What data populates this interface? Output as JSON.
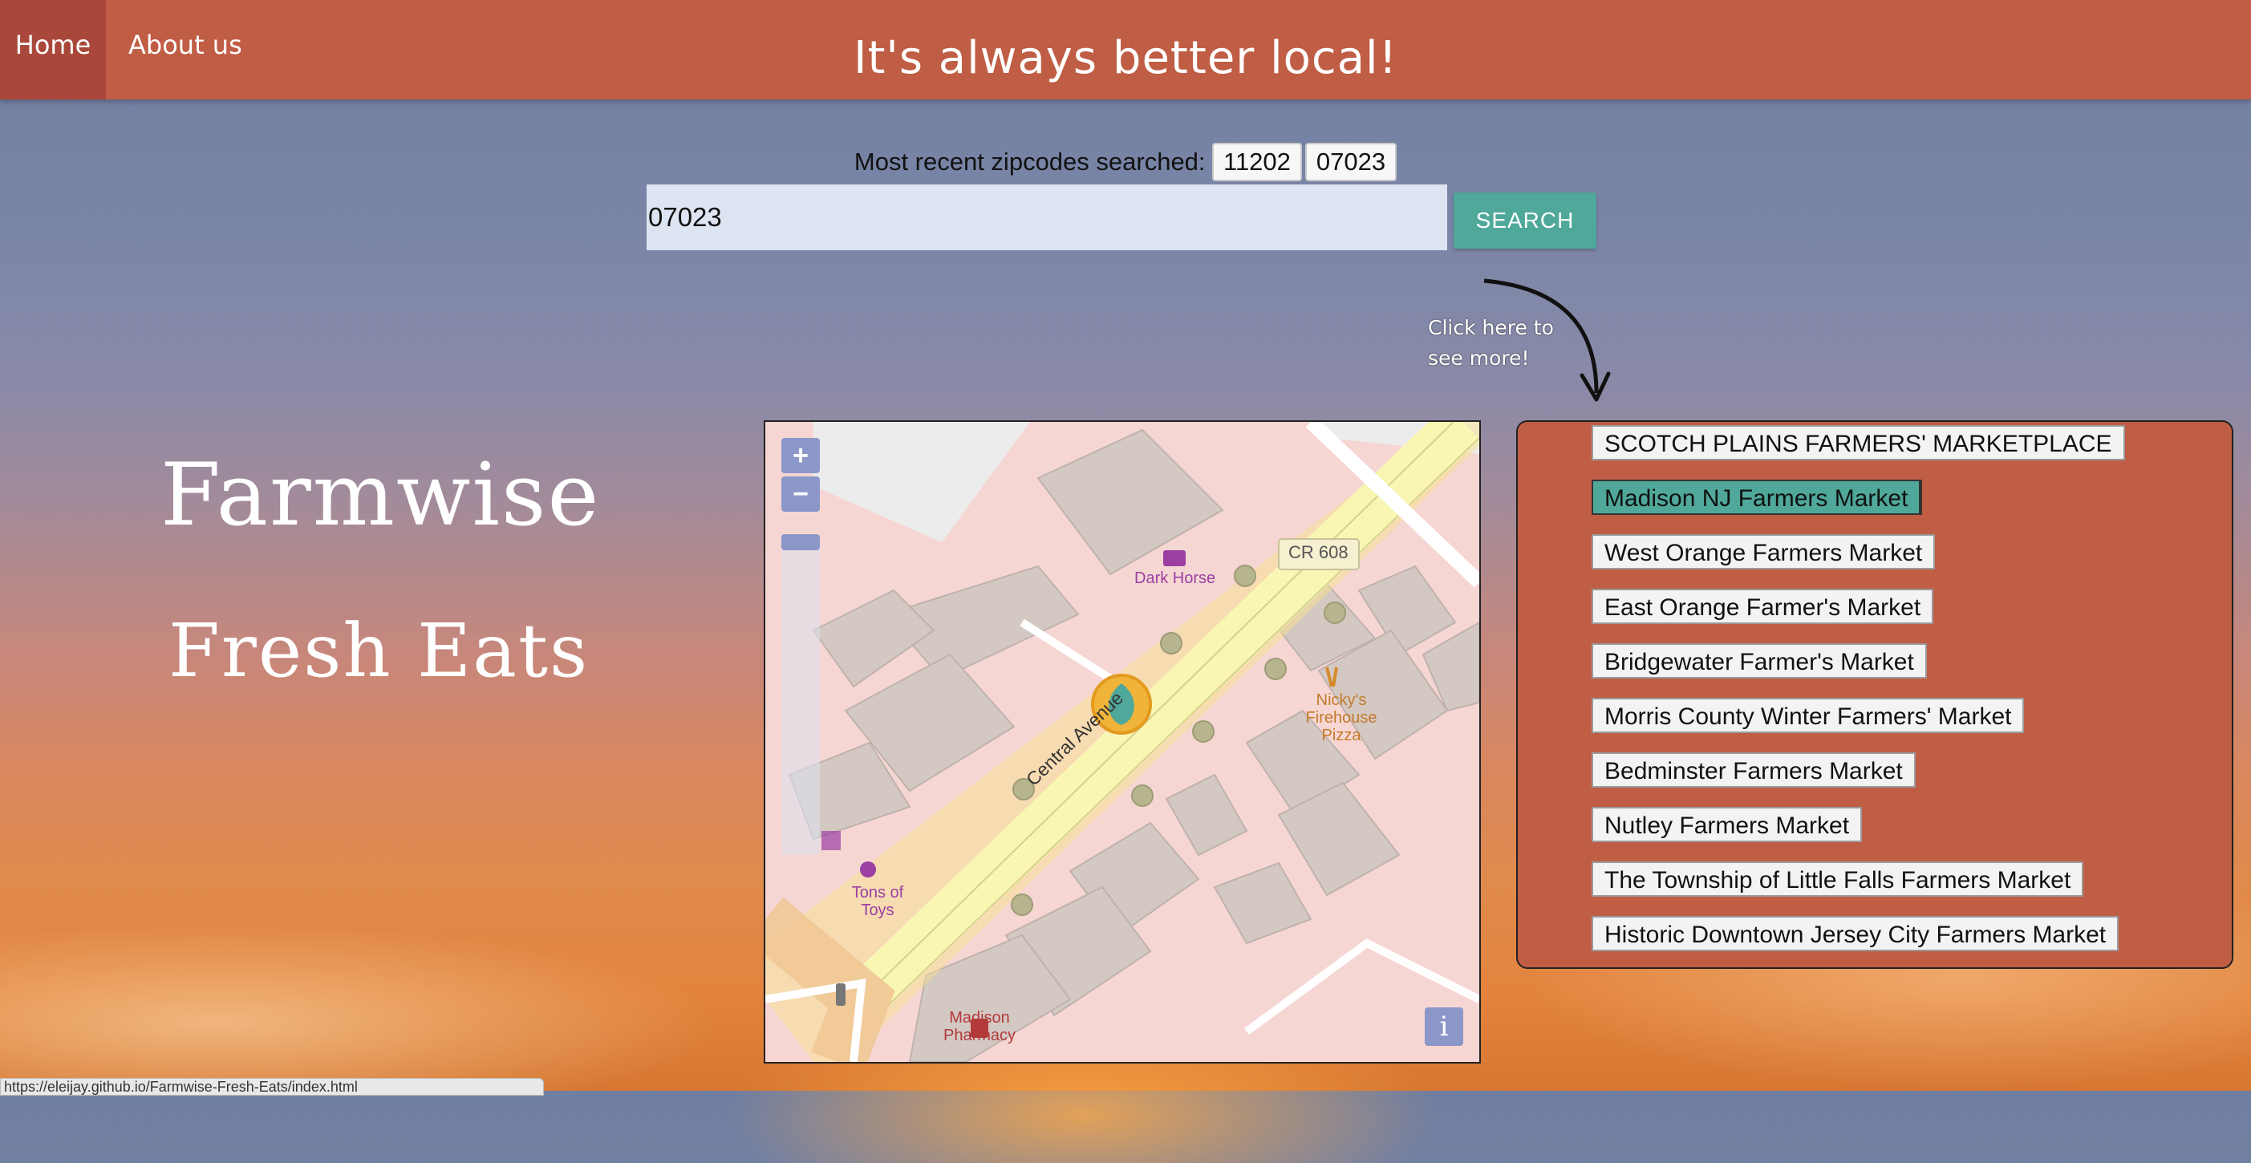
{
  "nav": {
    "home": "Home",
    "about": "About us",
    "tagline": "It's always better local!"
  },
  "search": {
    "recent_label": "Most recent zipcodes searched:",
    "recent": [
      "11202",
      "07023"
    ],
    "value": "07023",
    "button": "SEARCH"
  },
  "hint": {
    "line1": "Click here to",
    "line2": "see more!"
  },
  "brand": {
    "line1": "Farmwise",
    "line2": "Fresh Eats"
  },
  "map": {
    "zoom_in": "+",
    "zoom_out": "−",
    "info": "i",
    "road_label": "Central Avenue",
    "route_shield": "CR 608",
    "poi": {
      "dark_horse": "Dark Horse",
      "nickys_1": "Nicky's",
      "nickys_2": "Firehouse",
      "nickys_3": "Pizza",
      "tons_1": "Tons of",
      "tons_2": "Toys",
      "pharmacy_1": "Madison",
      "pharmacy_2": "Pharmacy"
    }
  },
  "markets": [
    "SCOTCH PLAINS FARMERS' MARKETPLACE",
    "Madison NJ Farmers Market",
    "West Orange Farmers Market",
    "East Orange Farmer's Market",
    "Bridgewater Farmer's Market",
    "Morris County Winter Farmers' Market",
    "Bedminster Farmers Market",
    "Nutley Farmers Market",
    "The Township of Little Falls Farmers Market",
    "Historic Downtown Jersey City Farmers Market"
  ],
  "selected_market_index": 1,
  "status_bar": "https://eleijay.github.io/Farmwise-Fresh-Eats/index.html",
  "colors": {
    "nav": "#c05d45",
    "accent": "#4fa89a",
    "panel": "#c05d45"
  }
}
